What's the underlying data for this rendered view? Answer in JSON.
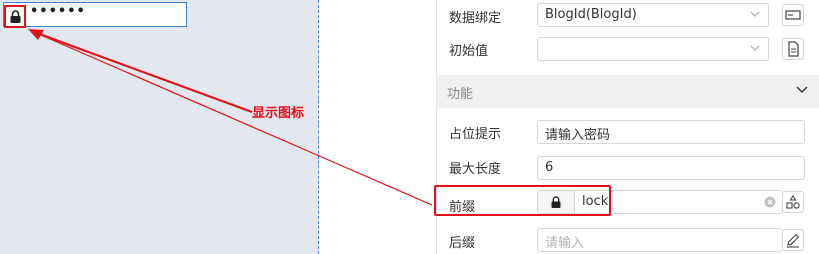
{
  "preview": {
    "password_dots": "••••••"
  },
  "annotation": {
    "text": "显示图标"
  },
  "panel": {
    "data_binding": {
      "label": "数据绑定",
      "value": "BlogId(BlogId)"
    },
    "initial_value": {
      "label": "初始值",
      "value": ""
    },
    "section": {
      "title": "功能"
    },
    "placeholder_hint": {
      "label": "占位提示",
      "value": "请输入密码"
    },
    "max_length": {
      "label": "最大长度",
      "value": "6"
    },
    "prefix": {
      "label": "前缀",
      "value": "lock"
    },
    "suffix": {
      "label": "后缀",
      "placeholder": "请输入"
    }
  },
  "colors": {
    "accent_red": "#e3111b",
    "focus_blue": "#3a87d6",
    "canvas_bg": "#e3e7ee"
  }
}
